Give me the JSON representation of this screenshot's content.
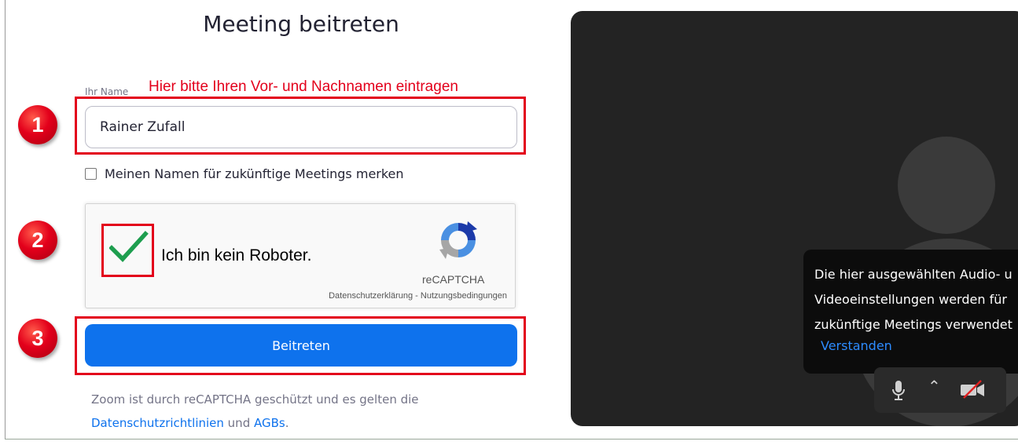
{
  "title": "Meeting beitreten",
  "name_field": {
    "label": "Ihr Name",
    "hint": "Hier bitte Ihren Vor- und Nachnamen eintragen",
    "value": "Rainer Zufall"
  },
  "remember": {
    "label": "Meinen Namen für zukünftige Meetings merken",
    "checked": false
  },
  "captcha": {
    "label": "Ich bin kein Roboter.",
    "checked": true,
    "brand": "reCAPTCHA",
    "privacy": "Datenschutzerklärung",
    "separator": " - ",
    "terms": "Nutzungsbedingungen"
  },
  "join_button": {
    "label": "Beitreten"
  },
  "note": {
    "text": "Zoom ist durch reCAPTCHA geschützt und es gelten die",
    "privacy_link": "Datenschutzrichtlinien",
    "conjunction": " und ",
    "terms_link": "AGBs",
    "period": "."
  },
  "badges": [
    "1",
    "2",
    "3"
  ],
  "preview": {
    "tooltip_lines": [
      "Die hier ausgewählten Audio- u",
      "Videoeinstellungen werden für",
      "zukünftige Meetings verwendet"
    ],
    "tooltip_action": "Verstanden",
    "icons": [
      "microphone-icon",
      "chevron-up-icon",
      "video-off-icon"
    ]
  },
  "colors": {
    "highlight_red": "#e3001b",
    "zoom_blue": "#0e72ed",
    "link_blue": "#2d8cff",
    "check_green": "#1e9e4f"
  }
}
